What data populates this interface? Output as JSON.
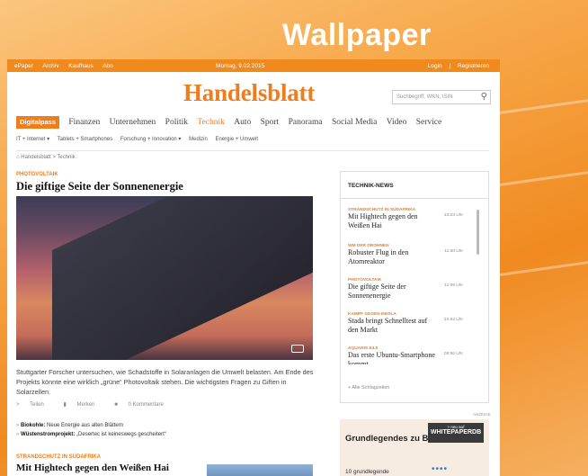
{
  "wallpaper_title": "Wallpaper",
  "topbar": {
    "links": [
      "ePaper",
      "Archiv",
      "Kaufhaus",
      "Abo"
    ],
    "date": "Montag, 9.02.2015",
    "login": "Login",
    "sep": "|",
    "register": "Registrieren"
  },
  "logo": "Handelsblatt",
  "search": {
    "placeholder": "Suchbegriff, WKN, ISIN"
  },
  "nav": {
    "items": [
      "Digitalpass",
      "Finanzen",
      "Unternehmen",
      "Politik",
      "Technik",
      "Auto",
      "Sport",
      "Panorama",
      "Social Media",
      "Video",
      "Service"
    ],
    "active": "Technik"
  },
  "subnav": [
    "IT + Internet ▾",
    "Tablets + Smartphones",
    "Forschung + Innovation ▾",
    "Medizin",
    "Energie + Umwelt"
  ],
  "breadcrumb": "⌂ Handelsblatt > Technik",
  "article": {
    "kicker": "PHOTOVOLTAIK",
    "title": "Die giftige Seite der Sonnenenergie",
    "lead": "Stuttgarter Forscher untersuchen, wie Schadstoffe in Solaranlagen die Umwelt belasten. Am Ende des Projekts könnte eine wirklich „grüne“ Photovoltaik stehen. Die wichtigsten Fragen zu Giften in Solarzellen.",
    "share": "Teilen",
    "bookmark": "Merken",
    "comments": "0 Kommentare",
    "related": [
      {
        "bold": "Biokohle:",
        "text": "Neue Energie aus alten Blättern"
      },
      {
        "bold": "Wüstenstromprojekt:",
        "text": "„Desertec ist keineswegs gescheitert“"
      }
    ]
  },
  "article2": {
    "kicker": "STRANDSCHUTZ IN SÜDAFRIKA",
    "title": "Mit Hightech gegen den Weißen Hai"
  },
  "news": {
    "header": "TECHNIK-NEWS",
    "items": [
      {
        "kicker": "STRANDSCHUTZ IN SÜDAFRIKA",
        "title": "Mit Hightech gegen den Weißen Hai",
        "time": "13:23 Uhr"
      },
      {
        "kicker": "WM DER DROHNEN",
        "title": "Robuster Flug in den Atomreaktor",
        "time": "11:50 Uhr"
      },
      {
        "kicker": "PHOTOVOLTAIK",
        "title": "Die giftige Seite der Sonnenenergie",
        "time": "11:09 Uhr"
      },
      {
        "kicker": "KAMPF GEGEN EBOLA",
        "title": "Stada bringt Schnelltest auf den Markt",
        "time": "10:52 Uhr"
      },
      {
        "kicker": "AQUARIS E4.5",
        "title": "Das erste Ubuntu-Smartphone kommt",
        "time": "09:56 Uhr"
      }
    ],
    "all": "+ Alle Schlagzeilen"
  },
  "ad": {
    "label": "ANZEIGE",
    "title": "Grundlegendes zu BYOD",
    "badge_top": "> neu auf",
    "badge": "WHITEPAPERDB",
    "snippet": "10 grundlegende"
  }
}
